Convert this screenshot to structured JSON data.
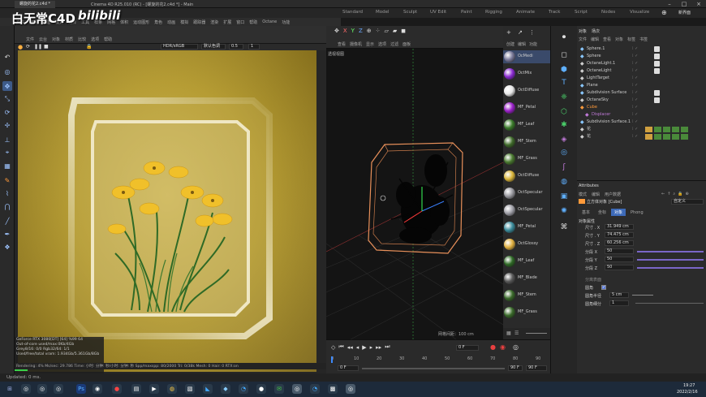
{
  "window": {
    "app_tab": "螺旋的花2.c4d *",
    "title": "Cinema 4D R25.010 (RC) - [螺旋的花2.c4d *] - Main"
  },
  "watermark": {
    "text": "白无常C4D",
    "brand": "bilibili"
  },
  "modes": [
    "Standard",
    "Model",
    "Sculpt",
    "UV Edit",
    "Paint",
    "Rigging",
    "Animate",
    "Track",
    "Script",
    "Nodes",
    "Visualize"
  ],
  "new_layout": "新界面",
  "menus": [
    "文件",
    "编辑",
    "创建",
    "模式",
    "选择",
    "工具",
    "样条",
    "网格",
    "体积",
    "运动图形",
    "角色",
    "动画",
    "模拟",
    "跟踪器",
    "渲染",
    "扩展",
    "窗口",
    "帮助",
    "Octane",
    "功能"
  ],
  "render_view": {
    "menus": [
      "文件",
      "云台",
      "对象",
      "材质",
      "比较",
      "选项",
      "帮助"
    ],
    "color_space": "HDR/sRGB",
    "preset": "默认色调",
    "value": "0.5",
    "value2": "1",
    "stats": [
      "GeForce RTX 3080[DT] [64]    %99    64",
      "Out-of-core used/max:0Kb/4Gb",
      "Grey8/16: 0/0          Rgb32/64: 1/1",
      "Used/free/total vram: 1.934Gb/5.361Gb/8Gb"
    ],
    "footer": "Rendering: 4%   Ms/sec: 29.786   Time: 小时: 分钟: 秒/小时: 分钟: 秒   Spp/maxspp: 80/2000   Tri: 0/38k   Mesh: 0   Hair: 0   RTX:on"
  },
  "viewport": {
    "menus": [
      "查看",
      "摄像机",
      "显示",
      "选项",
      "过滤",
      "面板"
    ],
    "label": "透视视图",
    "grid_label": "网格间距：100 cm"
  },
  "materials": {
    "menus": [
      "创建",
      "编辑",
      "功能"
    ],
    "items": [
      {
        "name": "OcMedi",
        "color": "#7a7a9a"
      },
      {
        "name": "OctMix",
        "color": "#8a2ad0"
      },
      {
        "name": "OctDiffuse",
        "color": "#e8e8e8"
      },
      {
        "name": "MF_Petal",
        "color": "#9a20c8"
      },
      {
        "name": "MF_Leaf",
        "color": "#3a7a2a"
      },
      {
        "name": "MF_Stem",
        "color": "#3f6a2a"
      },
      {
        "name": "MF_Grass",
        "color": "#4a7a30"
      },
      {
        "name": "OctDiffuse",
        "color": "#d9b53a"
      },
      {
        "name": "OctSpecular",
        "color": "#9a9aa0"
      },
      {
        "name": "OctSpecular",
        "color": "#a0a0a8"
      },
      {
        "name": "MF_Petal",
        "color": "#3a8a9a"
      },
      {
        "name": "OctGlossy",
        "color": "#e0b040"
      },
      {
        "name": "MF_Leaf",
        "color": "#2f6a26"
      },
      {
        "name": "MF_Blade",
        "color": "#5a5a5a"
      },
      {
        "name": "MF_Stem",
        "color": "#3a6a2a"
      },
      {
        "name": "MF_Grass",
        "color": "#3a6a2a"
      }
    ]
  },
  "objects": {
    "tabs": [
      "对象",
      "场次"
    ],
    "menus": [
      "文件",
      "编辑",
      "查看",
      "对象",
      "标签",
      "书签"
    ],
    "items": [
      {
        "name": "Sphere.1",
        "color": "#8ac8ff"
      },
      {
        "name": "Sphere",
        "color": "#8ac8ff"
      },
      {
        "name": "OctaneLight.1",
        "color": "#d0d0d0"
      },
      {
        "name": "OctaneLight",
        "color": "#d0d0d0"
      },
      {
        "name": "LightTarget",
        "color": "#d0d0d0"
      },
      {
        "name": "Plane",
        "color": "#8ac8ff"
      },
      {
        "name": "Subdivision Surface",
        "color": "#8ac8ff"
      },
      {
        "name": "OctaneSky",
        "color": "#d0d0d0"
      },
      {
        "name": "Cube",
        "color": "#ff9a3a"
      },
      {
        "name": "Displacer",
        "color": "#c07ad8"
      },
      {
        "name": "Subdivision Surface.1",
        "color": "#8ac8ff"
      },
      {
        "name": "花",
        "color": "#d0d0d0"
      },
      {
        "name": "花",
        "color": "#d0d0d0"
      }
    ]
  },
  "attributes": {
    "title": "Attributes",
    "menus": [
      "模式",
      "编辑",
      "用户数据"
    ],
    "object_label": "立方体对象 [Cube]",
    "preset": "自定义",
    "tabs": [
      "基本",
      "坐标",
      "对象",
      "Phong"
    ],
    "section": "对象属性",
    "params": [
      {
        "label": "尺寸 . X",
        "value": "31.949 cm"
      },
      {
        "label": "尺寸 . Y",
        "value": "74.475 cm"
      },
      {
        "label": "尺寸 . Z",
        "value": "60.256 cm"
      },
      {
        "label": "分段 X",
        "value": "50"
      },
      {
        "label": "分段 Y",
        "value": "50"
      },
      {
        "label": "分段 Z",
        "value": "50"
      }
    ],
    "separate_surfaces": "分离表面",
    "fillet": "圆角",
    "fillet_radius": {
      "label": "圆角半径",
      "value": "5 cm"
    },
    "fillet_subdiv": {
      "label": "圆角细分",
      "value": "1"
    }
  },
  "timeline": {
    "frame": "0 F",
    "ticks": [
      "0",
      "10",
      "20",
      "30",
      "40",
      "50",
      "60",
      "70",
      "80",
      "90"
    ],
    "start": "0 F",
    "end": "90 F",
    "end2": "90 F",
    "cur": "0 F"
  },
  "status": "Updated: 0 ms.",
  "taskbar": {
    "time": "19:27",
    "date": "2022/2/16"
  }
}
